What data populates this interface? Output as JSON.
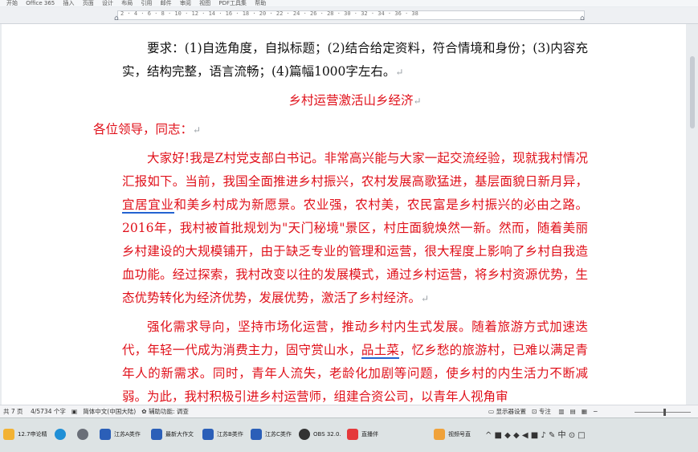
{
  "menubar": {
    "items": [
      "开始",
      "Office 365",
      "插入",
      "页面",
      "设计",
      "布局",
      "引用",
      "邮件",
      "审阅",
      "视图",
      "PDF工具集",
      "帮助"
    ]
  },
  "ruler": {
    "numbers": "2 · 4 · 6 · 8 · 10 · 12 · 14 · 16 · 18 · 20 · 22 · 24 · 26 · 28 · 30 · 32 · 34 · 36 · 38"
  },
  "document": {
    "requirement_line1": "要求：(1)自选角度，自拟标题；(2)结合给定资料，符合情境和身份；(3)内",
    "requirement_line2": "容充实，结构完整，语言流畅；(4)篇幅1000字左右。",
    "title": "乡村运营激活山乡经济",
    "greeting": "各位领导，同志：",
    "p1_a": "大家好!我是Z村党支部白书记。非常高兴能与大家一起交流经验，现就我村情况汇报如下。当前，我国全面推进乡村振兴，农村发展高歌猛进，基层面貌日新月异，",
    "p1_u": "宜居宜业",
    "p1_b": "和美乡村成为新愿景。农业强，农村美，农民富是乡村振兴的必由之路。2016年，我村被首批规划为\"天门秘境\"景区，村庄面貌焕然一新。然而，随着美丽乡村建设的大规模铺开，由于缺乏专业的管理和运营，很大程度上影响了乡村自我造血功能。经过探索，我村改变以往的发展模式，通过乡村运营，将乡村资源优势，生态优势转化为经济优势，发展优势，激活了乡村经济。",
    "p2_a": "强化需求导向，坚持市场化运营，推动乡村内生式发展。随着旅游方式加速迭代，年轻一代成为消费主力，固守赏山水，",
    "p2_u": "品土菜",
    "p2_b": "，忆乡愁的旅游村，已难以满足青年人的新需求。同时，青年人流失，老龄化加剧等问题，使乡村的内生活力不断减弱。为此，我村积极引进乡村运营师，组建合资公司，以青年人视角审"
  },
  "status": {
    "page": "共 7 页",
    "words": "4/5734 个字",
    "lang": "简体中文(中国大陆)",
    "assist": "辅助功能: 调查",
    "display": "显示器设置",
    "focus": "专注"
  },
  "taskbar": {
    "items": [
      {
        "label": "12.7申论精",
        "color": "#f2b233"
      },
      {
        "label": "",
        "color": "#1f8fd6"
      },
      {
        "label": "",
        "color": "#6a6f78"
      },
      {
        "label": "江苏A类作",
        "color": "#2b5fb8"
      },
      {
        "label": "最新大作文",
        "color": "#2b5fb8"
      },
      {
        "label": "江苏B类作",
        "color": "#2b5fb8"
      },
      {
        "label": "江苏C类作",
        "color": "#2b5fb8"
      },
      {
        "label": "OBS 32.0.",
        "color": "#333333"
      },
      {
        "label": "直播伴",
        "color": "#e5393b"
      },
      {
        "label": "视频号直",
        "color": "#f0a23a"
      }
    ],
    "tray": "^  ■  ◆  ◆  ◀  ■  ♪  ✎  中  ⊙  □"
  }
}
